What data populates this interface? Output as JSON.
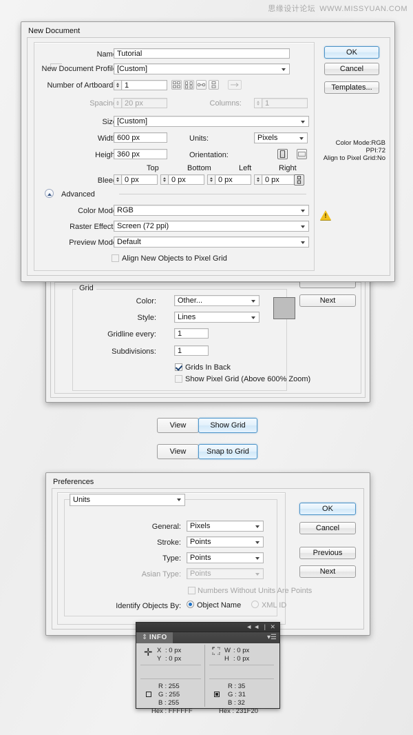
{
  "watermark": {
    "cn": "思缘设计论坛",
    "url": "WWW.MISSYUAN.COM"
  },
  "new_document": {
    "title": "New Document",
    "fields": {
      "name_label": "Name:",
      "name_value": "Tutorial",
      "profile_label": "New Document Profile:",
      "profile_value": "[Custom]",
      "artboards_label": "Number of Artboards:",
      "artboards_value": "1",
      "spacing_label": "Spacing:",
      "spacing_value": "20 px",
      "columns_label": "Columns:",
      "columns_value": "1",
      "size_label": "Size:",
      "size_value": "[Custom]",
      "width_label": "Width:",
      "width_value": "600 px",
      "units_label": "Units:",
      "units_value": "Pixels",
      "height_label": "Height:",
      "height_value": "360 px",
      "orientation_label": "Orientation:",
      "bleed_label": "Bleed:",
      "bleed_top_header": "Top",
      "bleed_bottom_header": "Bottom",
      "bleed_left_header": "Left",
      "bleed_right_header": "Right",
      "bleed_top": "0 px",
      "bleed_bottom": "0 px",
      "bleed_left": "0 px",
      "bleed_right": "0 px",
      "advanced_label": "Advanced",
      "color_mode_label": "Color Mode:",
      "color_mode_value": "RGB",
      "raster_label": "Raster Effects:",
      "raster_value": "Screen (72 ppi)",
      "preview_label": "Preview Mode:",
      "preview_value": "Default",
      "align_pixel_label": "Align New Objects to Pixel Grid"
    },
    "buttons": {
      "ok": "OK",
      "cancel": "Cancel",
      "templates": "Templates..."
    },
    "summary": {
      "color_mode": "Color Mode:RGB",
      "ppi": "PPI:72",
      "align": "Align to Pixel Grid:No"
    }
  },
  "grid_prefs": {
    "group_caption": "Grid",
    "color_label": "Color:",
    "color_value": "Other...",
    "style_label": "Style:",
    "style_value": "Lines",
    "gridline_label": "Gridline every:",
    "gridline_value": "1",
    "subdivisions_label": "Subdivisions:",
    "subdivisions_value": "1",
    "grids_in_back_label": "Grids In Back",
    "show_pixel_grid_label": "Show Pixel Grid (Above 600% Zoom)",
    "swatch_color": "#bdbdbd",
    "buttons": {
      "next": "Next"
    }
  },
  "menu_hints": [
    {
      "menu": "View",
      "item": "Show Grid"
    },
    {
      "menu": "View",
      "item": "Snap to Grid"
    }
  ],
  "preferences": {
    "title": "Preferences",
    "section_value": "Units",
    "general_label": "General:",
    "general_value": "Pixels",
    "stroke_label": "Stroke:",
    "stroke_value": "Points",
    "type_label": "Type:",
    "type_value": "Points",
    "asian_label": "Asian Type:",
    "asian_value": "Points",
    "numbers_label": "Numbers Without Units Are Points",
    "identify_label": "Identify Objects By:",
    "radio_object_name": "Object Name",
    "radio_xml_id": "XML ID",
    "buttons": {
      "ok": "OK",
      "cancel": "Cancel",
      "previous": "Previous",
      "next": "Next"
    }
  },
  "info_panel": {
    "tab": "INFO",
    "x_label": "X",
    "x_value": ": 0 px",
    "y_label": "Y",
    "y_value": ": 0 px",
    "w_label": "W",
    "w_value": ": 0 px",
    "h_label": "H",
    "h_value": ": 0 px",
    "fill": {
      "r": "R : 255",
      "g": "G : 255",
      "b": "B : 255",
      "hex": "Hex : FFFFFF"
    },
    "stroke": {
      "r": "R : 35",
      "g": "G : 31",
      "b": "B : 32",
      "hex": "Hex : 231F20"
    }
  }
}
